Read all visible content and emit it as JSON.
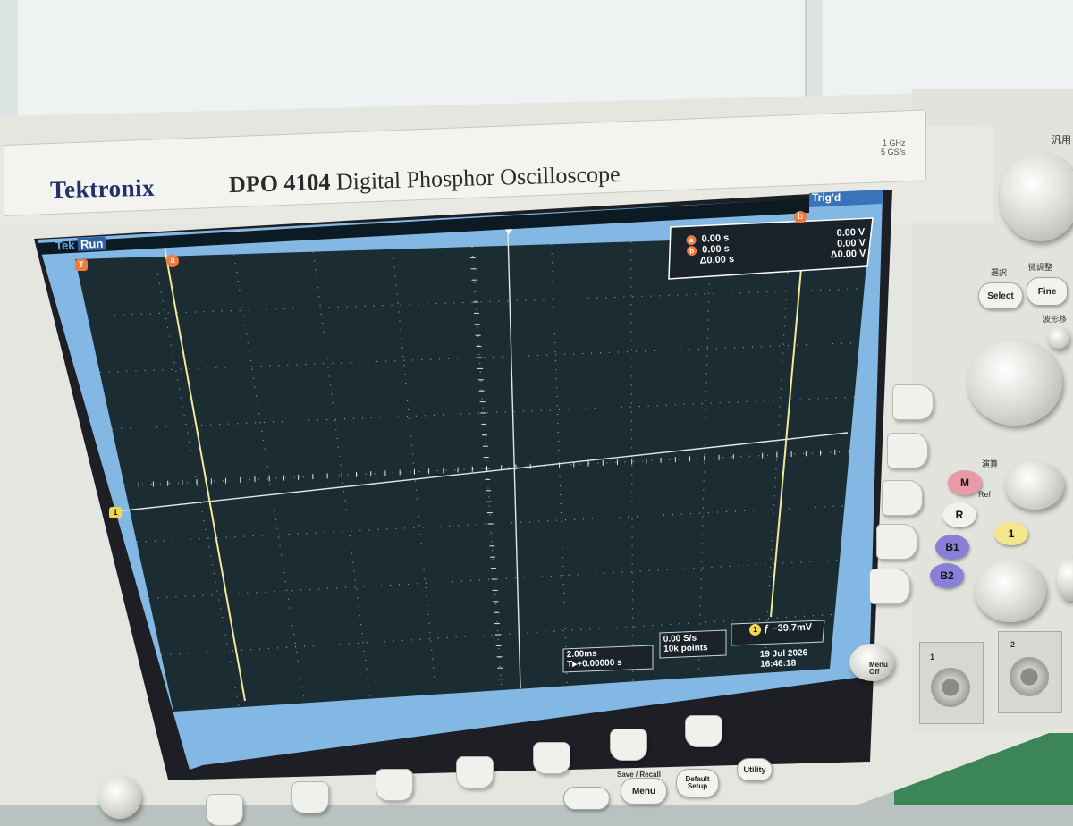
{
  "brand": "Tektronix",
  "model_number": "DPO 4104",
  "model_desc": "Digital Phosphor Oscilloscope",
  "spec_bandwidth": "1 GHz",
  "spec_sample_rate": "5 GS/s",
  "screen": {
    "tek_label": "Tek",
    "run_label": "Run",
    "trig_label": "Trig'd",
    "cursor_readout": {
      "a_time": "0.00 s",
      "a_volt": "0.00 V",
      "b_time": "0.00 s",
      "b_volt": "0.00 V",
      "delta_time": "Δ0.00 s",
      "delta_volt": "Δ0.00 V"
    },
    "cursor_a_marker": "a",
    "cursor_b_marker": "b",
    "ch1_marker": "1",
    "trigger_marker": "T",
    "timebase": "2.00ms",
    "trigger_pos": "T▸+0.00000 s",
    "sample_rate": "0.00 S/s",
    "record_length": "10k points",
    "trigger_channel": "1",
    "trigger_level": "ƒ −39.7mV",
    "date": "19 Jul  2026",
    "time": "16:46:18"
  },
  "panel": {
    "select_label": "Select",
    "fine_label": "Fine",
    "jp_select": "選択",
    "jp_fine": "微調整",
    "jp_general": "汎用",
    "jp_waveform": "波形移",
    "jp_math": "演算",
    "ref_label": "Ref",
    "m_label": "M",
    "r_label": "R",
    "b1_label": "B1",
    "b2_label": "B2",
    "ch1_label": "1",
    "menu_off": "Menu Off",
    "save_recall": "Save / Recall",
    "menu_label": "Menu",
    "default_setup": "Default Setup",
    "utility_label": "Utility",
    "bnc1": "1",
    "bnc2": "2"
  },
  "colors": {
    "grid_bg": "#1c2c33",
    "cursor": "#f4e89a",
    "ch1": "#f4d84c",
    "screen_border": "#84b9e6",
    "badge_orange": "#f07a3c"
  }
}
